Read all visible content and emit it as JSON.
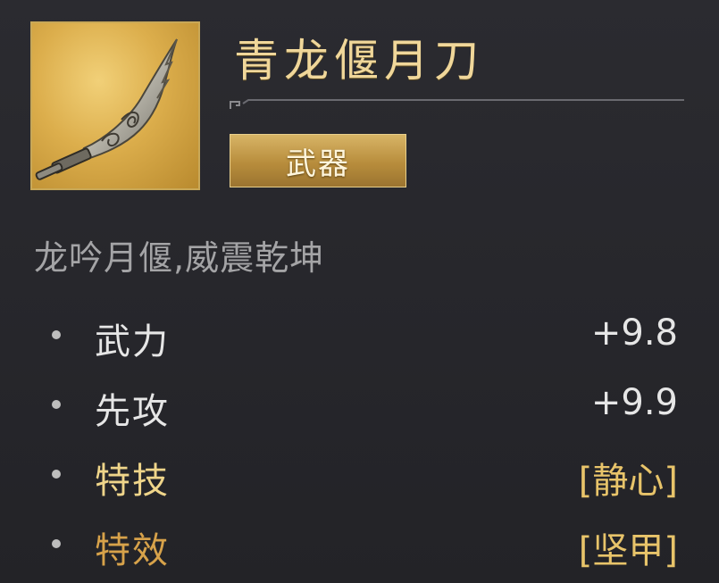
{
  "item": {
    "name": "青龙偃月刀",
    "type": "武器",
    "description": "龙吟月偃,威震乾坤",
    "icon": "crescent-blade-icon"
  },
  "stats": [
    {
      "label": "武力",
      "value": "+9.8"
    },
    {
      "label": "先攻",
      "value": "+9.9"
    },
    {
      "label": "特技",
      "value": "[静心]"
    },
    {
      "label": "特效",
      "value": "[坚甲]"
    }
  ],
  "colors": {
    "title": "#f0d79a",
    "frame_border": "#c9a857",
    "stat_normal": "#e6e6e6",
    "stat_special_label": "#efd58a",
    "stat_effect_label": "#d7a24a",
    "stat_bracket": "#e8c46a",
    "description": "#a4a4a6"
  }
}
